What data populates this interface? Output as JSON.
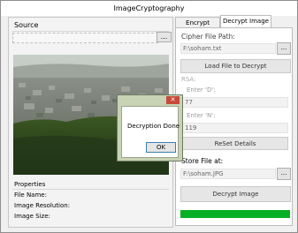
{
  "window": {
    "title": "ImageCryptography",
    "minimize_glyph": "—",
    "maximize_glyph": "□",
    "close_glyph": "✕"
  },
  "source": {
    "label": "Source",
    "path_value": "",
    "browse_label": "..."
  },
  "properties": {
    "title": "Properties",
    "file_name_label": "File Name:",
    "resolution_label": "Image Resolution:",
    "size_label": "Image Size:"
  },
  "tabs": [
    {
      "label": "Encrypt Image",
      "selected": false
    },
    {
      "label": "Decrypt Image",
      "selected": true
    }
  ],
  "decrypt": {
    "cipher_label": "Cipher File Path:",
    "cipher_value": "F:\\soham.txt",
    "cipher_browse": "...",
    "load_button": "Load File to Decrypt",
    "rsa_label": "RSA:",
    "d_label": "Enter 'D':",
    "d_value": "77",
    "n_label": "Enter 'N':",
    "n_value": "119",
    "reset_button": "ReSet Details",
    "store_label": "Store File at:",
    "store_value": "F:\\soham.JPG",
    "store_browse": "...",
    "decrypt_button": "Decrypt Image",
    "progress": 1.0
  },
  "dialog": {
    "message": "Decryption Done",
    "ok_label": "OK",
    "close_glyph": "✕"
  },
  "colors": {
    "progress": "#06b025",
    "dialog_frame": "#c8d3b6",
    "close_button": "#c7483a"
  }
}
